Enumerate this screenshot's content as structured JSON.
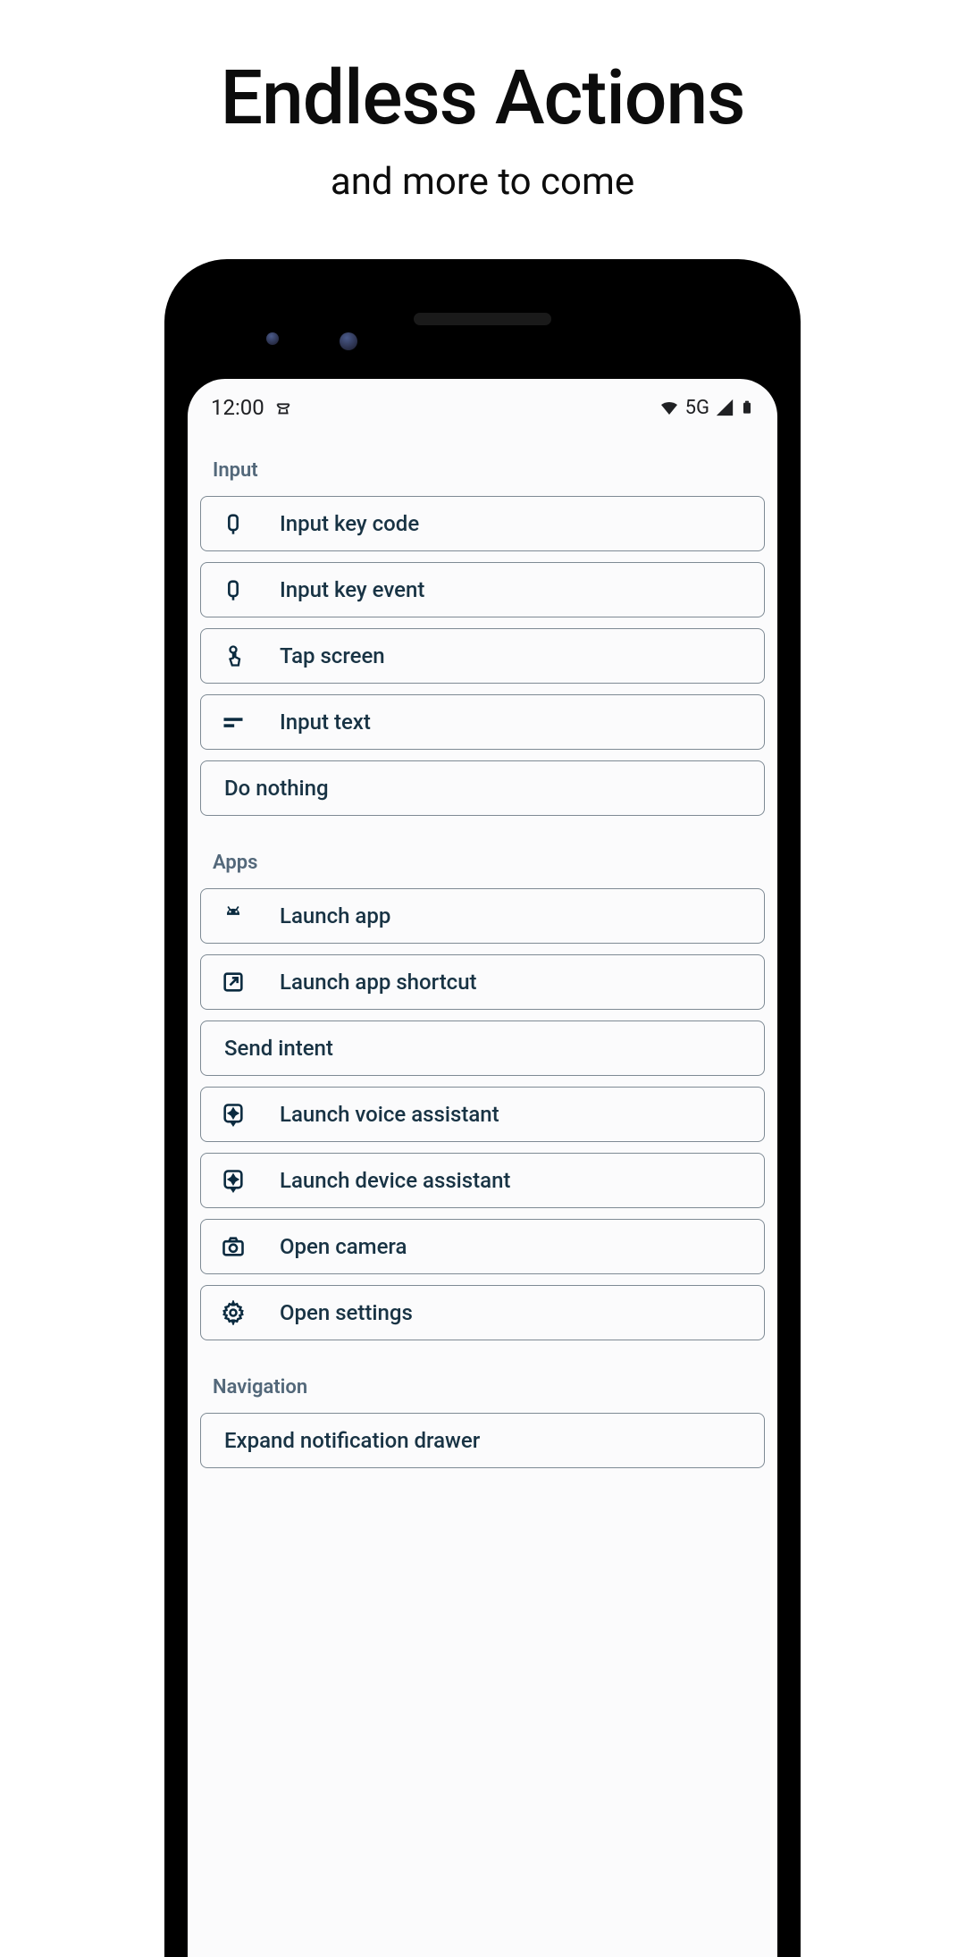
{
  "header": {
    "title": "Endless Actions",
    "subtitle": "and more to come"
  },
  "status": {
    "time": "12:00",
    "network": "5G"
  },
  "sections": {
    "input": {
      "title": "Input",
      "items": {
        "key_code": "Input key code",
        "key_event": "Input key event",
        "tap_screen": "Tap screen",
        "input_text": "Input text",
        "do_nothing": "Do nothing"
      }
    },
    "apps": {
      "title": "Apps",
      "items": {
        "launch_app": "Launch app",
        "launch_shortcut": "Launch app shortcut",
        "send_intent": "Send intent",
        "voice_assistant": "Launch voice assistant",
        "device_assistant": "Launch device assistant",
        "open_camera": "Open camera",
        "open_settings": "Open settings"
      }
    },
    "navigation": {
      "title": "Navigation",
      "items": {
        "expand_notifications": "Expand notification drawer"
      }
    }
  }
}
